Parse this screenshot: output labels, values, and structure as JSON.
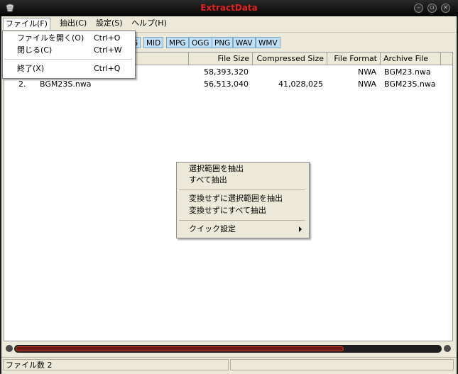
{
  "window": {
    "title": "ExtractData"
  },
  "menubar": [
    {
      "label": "ファイル(F)",
      "active": true
    },
    {
      "label": "抽出(C)"
    },
    {
      "label": "設定(S)"
    },
    {
      "label": "ヘルプ(H)"
    }
  ],
  "toolbar": {
    "buttons": [
      "G",
      "MID",
      "MPG",
      "OGG",
      "PNG",
      "WAV",
      "WMV"
    ]
  },
  "file_menu": {
    "items": [
      {
        "label": "ファイルを開く(O)",
        "shortcut": "Ctrl+O"
      },
      {
        "label": "閉じる(C)",
        "shortcut": "Ctrl+W"
      },
      {
        "label": "終了(X)",
        "shortcut": "Ctrl+Q"
      }
    ]
  },
  "table": {
    "columns": [
      "File Size",
      "Compressed Size",
      "File Format",
      "Archive File"
    ],
    "rows": [
      {
        "index": "",
        "name": "",
        "size": "58,393,320",
        "compressed": "",
        "format": "NWA",
        "archive": "BGM23.nwa"
      },
      {
        "index": "2.",
        "name": "BGM23S.nwa",
        "size": "56,513,040",
        "compressed": "41,028,025",
        "format": "NWA",
        "archive": "BGM23S.nwa"
      }
    ]
  },
  "context_menu": {
    "items": [
      {
        "label": "選択範囲を抽出"
      },
      {
        "label": "すべて抽出"
      },
      {
        "label": "変換せずに選択範囲を抽出"
      },
      {
        "label": "変換せずにすべて抽出"
      },
      {
        "label": "クイック設定",
        "submenu": true
      }
    ]
  },
  "statusbar": {
    "text": "ファイル数 2"
  }
}
